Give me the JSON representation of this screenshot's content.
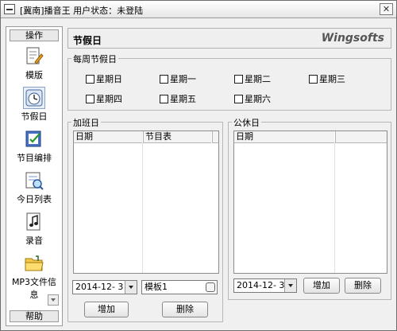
{
  "window": {
    "title": "[冀南]播音王  用户状态：未登陆",
    "close_symbol": "✕"
  },
  "sidebar": {
    "header": "操作",
    "footer": "帮助",
    "items": [
      {
        "label": "模版",
        "icon": "template-icon"
      },
      {
        "label": "节假日",
        "icon": "holiday-icon",
        "active": true
      },
      {
        "label": "节目编排",
        "icon": "schedule-icon"
      },
      {
        "label": "今日列表",
        "icon": "today-list-icon"
      },
      {
        "label": "录音",
        "icon": "recording-icon"
      },
      {
        "label": "MP3文件信息",
        "icon": "mp3-folder-icon"
      }
    ]
  },
  "header": {
    "title": "节假日",
    "brand": "Wingsofts"
  },
  "weekly_holidays": {
    "legend": "每周节假日",
    "days": [
      "星期日",
      "星期一",
      "星期二",
      "星期三",
      "星期四",
      "星期五",
      "星期六"
    ]
  },
  "workday": {
    "legend": "加班日",
    "columns": [
      "日期",
      "节目表"
    ],
    "date_value": "2014-12- 3",
    "template_value": "模板1",
    "add_label": "增加",
    "delete_label": "删除"
  },
  "restday": {
    "legend": "公休日",
    "columns": [
      "日期"
    ],
    "date_value": "2014-12- 3",
    "add_label": "增加",
    "delete_label": "删除"
  },
  "colors": {
    "window_bg": "#f0f0f0",
    "border": "#b7b7b7",
    "sidebar_bg": "#ffffff"
  }
}
